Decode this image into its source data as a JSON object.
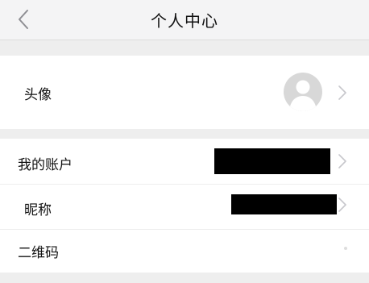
{
  "header": {
    "title": "个人中心",
    "back_icon": "chevron-left-icon"
  },
  "rows": {
    "avatar": {
      "label": "头像",
      "icon": "avatar-placeholder-icon"
    },
    "account": {
      "label": "我的账户",
      "value_redacted": true
    },
    "nickname": {
      "label": "昵称",
      "value_redacted": true
    },
    "qrcode": {
      "label": "二维码"
    }
  },
  "colors": {
    "background": "#eeeeee",
    "nav_background": "#f4f4f5",
    "row_background": "#ffffff",
    "chevron": "#c7c7cc",
    "avatar_bg": "#d8d8d8"
  }
}
